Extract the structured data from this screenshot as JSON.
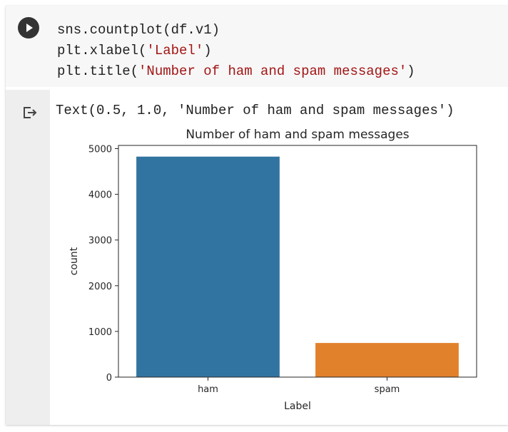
{
  "cell": {
    "run_button_icon": "play-icon",
    "code": {
      "line1": "sns.countplot(df.v1)",
      "line2_prefix": "plt.xlabel(",
      "line2_string": "'Label'",
      "line2_suffix": ")",
      "line3_prefix": "plt.title(",
      "line3_string": "'Number of ham and spam messages'",
      "line3_suffix": ")"
    },
    "output": {
      "icon": "output-arrow-icon",
      "text": "Text(0.5, 1.0, 'Number of ham and spam messages')"
    }
  },
  "chart_data": {
    "type": "bar",
    "title": "Number of ham and spam messages",
    "xlabel": "Label",
    "ylabel": "count",
    "categories": [
      "ham",
      "spam"
    ],
    "values": [
      4825,
      747
    ],
    "colors": [
      "#3274a1",
      "#e1812c"
    ],
    "ylim": [
      0,
      5070
    ],
    "yticks": [
      0,
      1000,
      2000,
      3000,
      4000,
      5000
    ],
    "ytick_labels": [
      "0",
      "1000",
      "2000",
      "3000",
      "4000",
      "5000"
    ],
    "grid": false,
    "legend": false
  }
}
